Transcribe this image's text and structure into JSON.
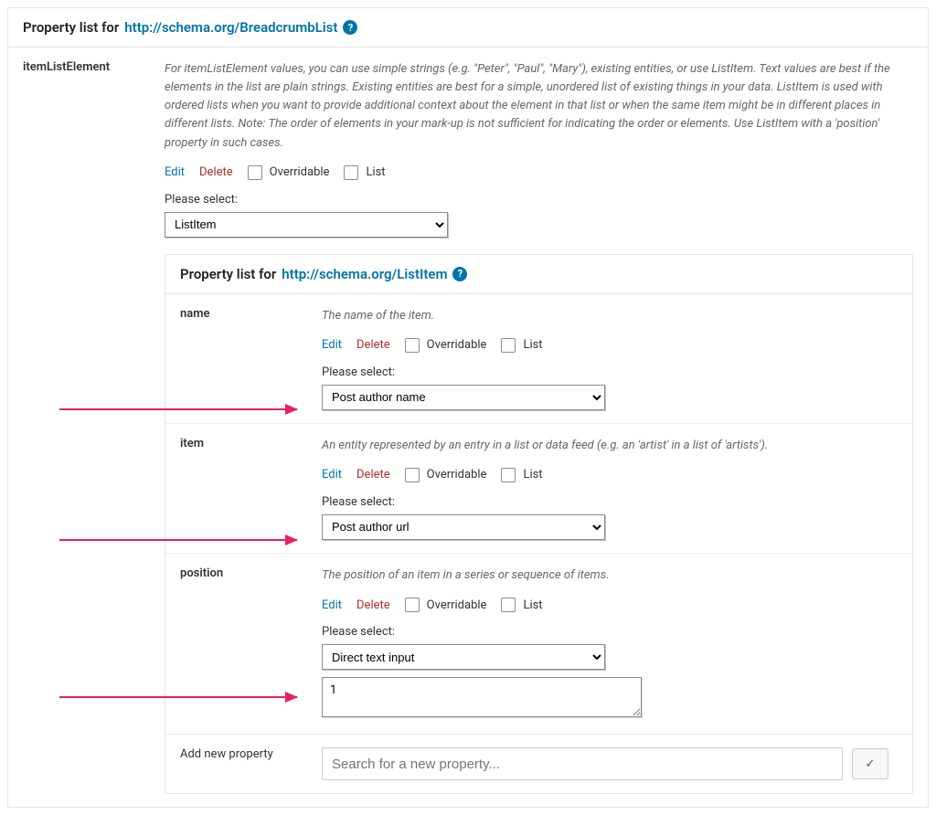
{
  "outer_panel": {
    "title_prefix": "Property list for",
    "title_link": "http://schema.org/BreadcrumbList",
    "help_glyph": "?"
  },
  "itemListElement": {
    "label": "itemListElement",
    "description": "For itemListElement values, you can use simple strings (e.g. \"Peter\", \"Paul\", \"Mary\"), existing entities, or use ListItem. Text values are best if the elements in the list are plain strings. Existing entities are best for a simple, unordered list of existing things in your data. ListItem is used with ordered lists when you want to provide additional context about the element in that list or when the same item might be in different places in different lists. Note: The order of elements in your mark-up is not sufficient for indicating the order or elements. Use ListItem with a 'position' property in such cases.",
    "actions": {
      "edit": "Edit",
      "delete": "Delete",
      "overridable": "Overridable",
      "list": "List"
    },
    "select_label": "Please select:",
    "select_value": "ListItem"
  },
  "inner_panel": {
    "title_prefix": "Property list for",
    "title_link": "http://schema.org/ListItem",
    "help_glyph": "?"
  },
  "props": {
    "name": {
      "label": "name",
      "description": "The name of the item.",
      "actions": {
        "edit": "Edit",
        "delete": "Delete",
        "overridable": "Overridable",
        "list": "List"
      },
      "select_label": "Please select:",
      "select_value": "Post author name"
    },
    "item": {
      "label": "item",
      "description": "An entity represented by an entry in a list or data feed (e.g. an 'artist' in a list of 'artists').",
      "actions": {
        "edit": "Edit",
        "delete": "Delete",
        "overridable": "Overridable",
        "list": "List"
      },
      "select_label": "Please select:",
      "select_value": "Post author url"
    },
    "position": {
      "label": "position",
      "description": "The position of an item in a series or sequence of items.",
      "actions": {
        "edit": "Edit",
        "delete": "Delete",
        "overridable": "Overridable",
        "list": "List"
      },
      "select_label": "Please select:",
      "select_value": "Direct text input",
      "text_value": "1"
    }
  },
  "add_new": {
    "label": "Add new property",
    "placeholder": "Search for a new property..."
  }
}
